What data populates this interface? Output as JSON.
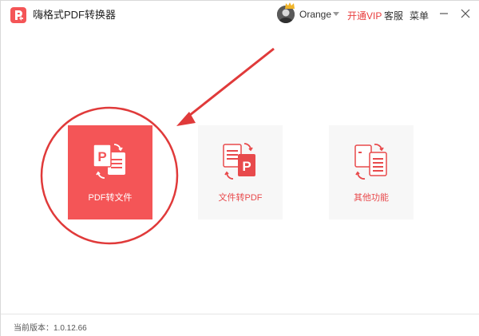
{
  "app": {
    "title": "嗨格式PDF转换器"
  },
  "header": {
    "username": "Orange",
    "vip_label": "开通VIP",
    "service_label": "客服",
    "menu_label": "菜单"
  },
  "cards": [
    {
      "label": "PDF转文件",
      "icon": "pdf-to-file-icon"
    },
    {
      "label": "文件转PDF",
      "icon": "file-to-pdf-icon"
    },
    {
      "label": "其他功能",
      "icon": "other-functions-icon"
    }
  ],
  "status": {
    "version": "当前版本：1.0.12.66"
  },
  "colors": {
    "accent": "#f45557",
    "vip": "#e83d3d",
    "card_bg": "#f7f7f7",
    "annotation": "#e03a3a"
  }
}
